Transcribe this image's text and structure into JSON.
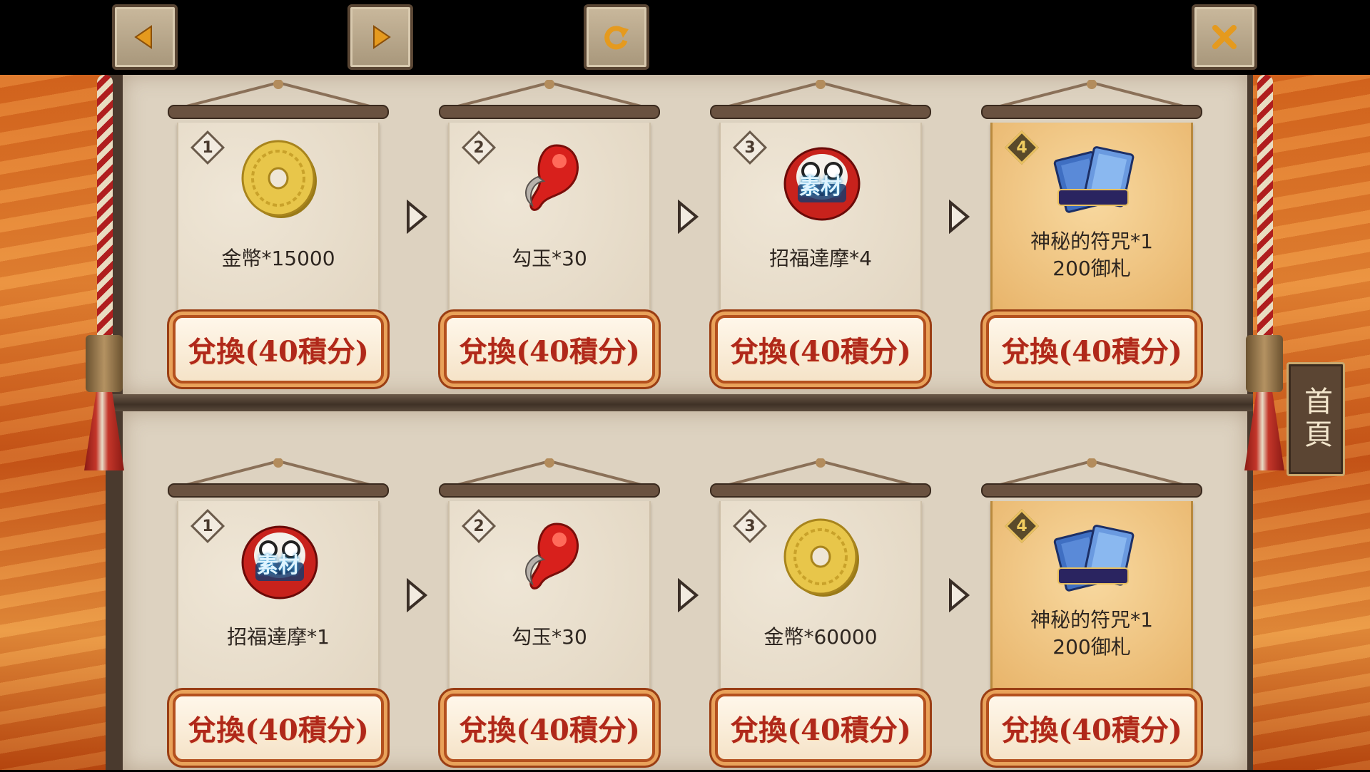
{
  "topbar": {
    "back_icon": "triangle-left-icon",
    "forward_icon": "triangle-right-icon",
    "refresh_icon": "refresh-icon",
    "close_icon": "close-icon"
  },
  "side_tab": {
    "label": "首頁"
  },
  "rows": [
    {
      "cards": [
        {
          "step": "1",
          "item": "金幣*15000",
          "item_line2": "",
          "icon": "gold-coin-icon",
          "button": "兌換(40積分)",
          "highlight": false
        },
        {
          "step": "2",
          "item": "勾玉*30",
          "item_line2": "",
          "icon": "red-magatama-icon",
          "button": "兌換(40積分)",
          "highlight": false
        },
        {
          "step": "3",
          "item": "招福達摩*4",
          "item_line2": "",
          "icon": "daruma-icon",
          "button": "兌換(40積分)",
          "highlight": false
        },
        {
          "step": "4",
          "item": "神秘的符咒*1",
          "item_line2": "200御札",
          "icon": "mystery-talisman-icon",
          "button": "兌換(40積分)",
          "highlight": true
        }
      ]
    },
    {
      "cards": [
        {
          "step": "1",
          "item": "招福達摩*1",
          "item_line2": "",
          "icon": "daruma-icon",
          "button": "兌換(40積分)",
          "highlight": false
        },
        {
          "step": "2",
          "item": "勾玉*30",
          "item_line2": "",
          "icon": "red-magatama-icon",
          "button": "兌換(40積分)",
          "highlight": false
        },
        {
          "step": "3",
          "item": "金幣*60000",
          "item_line2": "",
          "icon": "gold-coin-icon",
          "button": "兌換(40積分)",
          "highlight": false
        },
        {
          "step": "4",
          "item": "神秘的符咒*1",
          "item_line2": "200御札",
          "icon": "mystery-talisman-icon",
          "button": "兌換(40積分)",
          "highlight": true
        }
      ]
    }
  ],
  "daruma_label": "素材",
  "colors": {
    "button_text": "#b0281a",
    "gold_card": "#e8b46a",
    "panel": "#ddd2c0"
  }
}
